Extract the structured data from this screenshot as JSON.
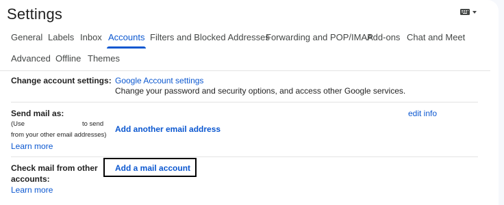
{
  "header": {
    "title": "Settings",
    "keyboard_icon": "keyboard-icon",
    "caret_icon": "arrow-drop-down-icon"
  },
  "tabs": [
    {
      "label": "General",
      "active": false
    },
    {
      "label": "Labels",
      "active": false
    },
    {
      "label": "Inbox",
      "active": false
    },
    {
      "label": "Accounts",
      "active": true
    },
    {
      "label": "Filters and Blocked Addresses",
      "active": false
    },
    {
      "label": "Forwarding and POP/IMAP",
      "active": false
    },
    {
      "label": "Add-ons",
      "active": false
    },
    {
      "label": "Chat and Meet",
      "active": false
    },
    {
      "label": "Advanced",
      "active": false
    },
    {
      "label": "Offline",
      "active": false
    },
    {
      "label": "Themes",
      "active": false
    }
  ],
  "sections": {
    "change_account": {
      "label": "Change account settings:",
      "link": "Google Account settings",
      "description": "Change your password and security options, and access other Google services."
    },
    "send_mail": {
      "label": "Send mail as:",
      "note_line1_a": "(Use",
      "note_line1_b": "to send",
      "note_line2": "from your other email addresses)",
      "learn_more": "Learn more",
      "add_link": "Add another email address",
      "edit_info": "edit info"
    },
    "check_mail": {
      "label_line1": "Check mail from other",
      "label_line2": "accounts:",
      "learn_more": "Learn more",
      "add_link": "Add a mail account"
    }
  },
  "colors": {
    "accent": "#0b57d0",
    "text": "#1f1f1f",
    "muted": "#444746",
    "divider": "#e3e3e3",
    "background": "#f6f8fc"
  }
}
